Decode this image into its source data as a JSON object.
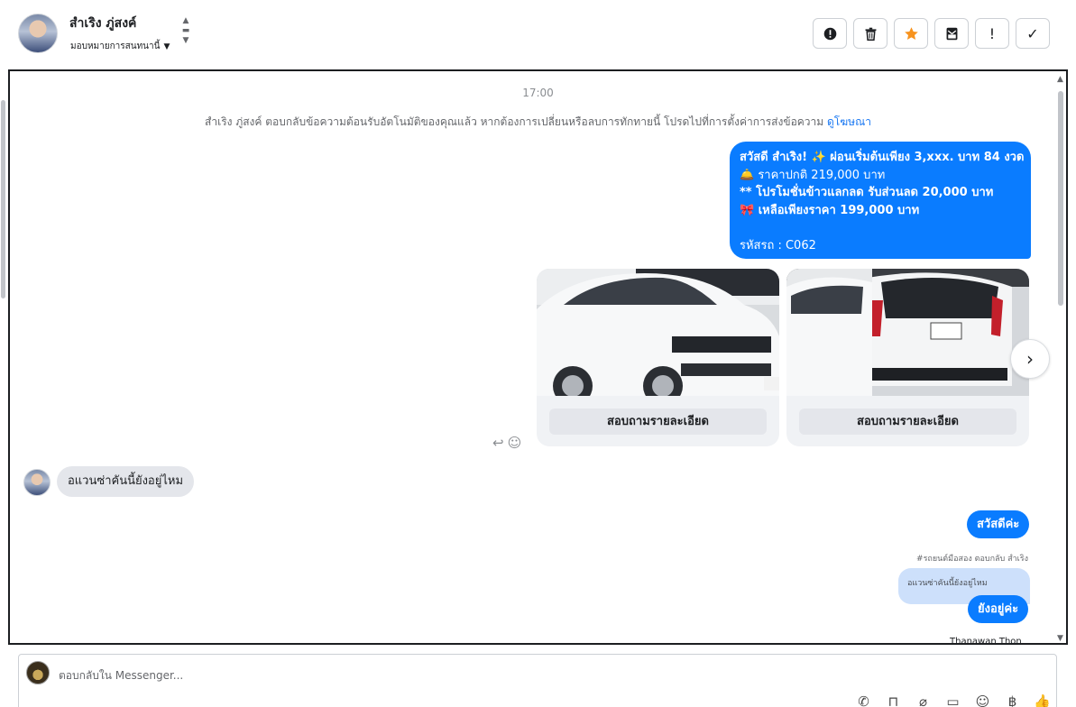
{
  "header": {
    "contact_name": "สำเริง ภู่สงค์",
    "assign_label": "มอบหมายการสนทนานี้",
    "toolbar": [
      {
        "name": "report-button",
        "icon": "exclamation-circle-icon"
      },
      {
        "name": "delete-button",
        "icon": "trash-icon"
      },
      {
        "name": "star-button",
        "icon": "star-icon",
        "color": "#f7931e"
      },
      {
        "name": "mark-unread-button",
        "icon": "envelope-icon"
      },
      {
        "name": "priority-button",
        "icon": "exclamation-icon",
        "glyph": "!"
      },
      {
        "name": "done-button",
        "icon": "check-icon",
        "glyph": "✓"
      }
    ]
  },
  "conversation": {
    "time": "17:00",
    "system_message": "สำเริง ภู่สงค์ ตอบกลับข้อความต้อนรับอัตโนมัติของคุณแล้ว หากต้องการเปลี่ยนหรือลบการทักทายนี้ โปรดไปที่การตั้งค่าการส่งข้อความ",
    "system_link": "ดูโฆษณา",
    "promo_lines": [
      "สวัสดี สำเริง! ✨  ผ่อนเริ่มต้นเพียง 3,xxx. บาท 84 งวด",
      "🛎️ ราคาปกติ 219,000 บาท",
      "** โปรโมชั่นข้าวแลกลด รับส่วนลด 20,000 บาท",
      "🎀  เหลือเพียงราคา 199,000 บาท",
      "",
      " รหัสรถ : C062"
    ],
    "cards": [
      {
        "button": "สอบถามรายละเอียด",
        "image": "white-toyota-avanza-front"
      },
      {
        "button": "สอบถามรายละเอียด",
        "image": "white-toyota-avanza-rear"
      }
    ],
    "incoming_message": "อแวนซ่าคันนี้ยังอยู่ไหม",
    "outgoing_greeting": "สวัสดีค่ะ",
    "reply_meta": "#รถยนต์มือสอง ตอบกลับ สำเริง",
    "quoted_text": "อแวนซ่าคันนี้ยังอยู่ไหม",
    "outgoing_reply": "ยังอยู่ค่ะ",
    "sender_name": "Thanawan Thon"
  },
  "composer": {
    "placeholder": "ตอบกลับใน Messenger...",
    "tools": [
      "phone-add-icon",
      "shopping-bag-icon",
      "paperclip-icon",
      "chat-bubble-icon",
      "emoji-icon",
      "baht-icon",
      "thumbs-up-icon"
    ]
  },
  "colors": {
    "accent": "#0a7cff",
    "incoming_bubble": "#e4e6eb",
    "quoted_bubble": "#cde0fb",
    "star": "#f7931e"
  }
}
